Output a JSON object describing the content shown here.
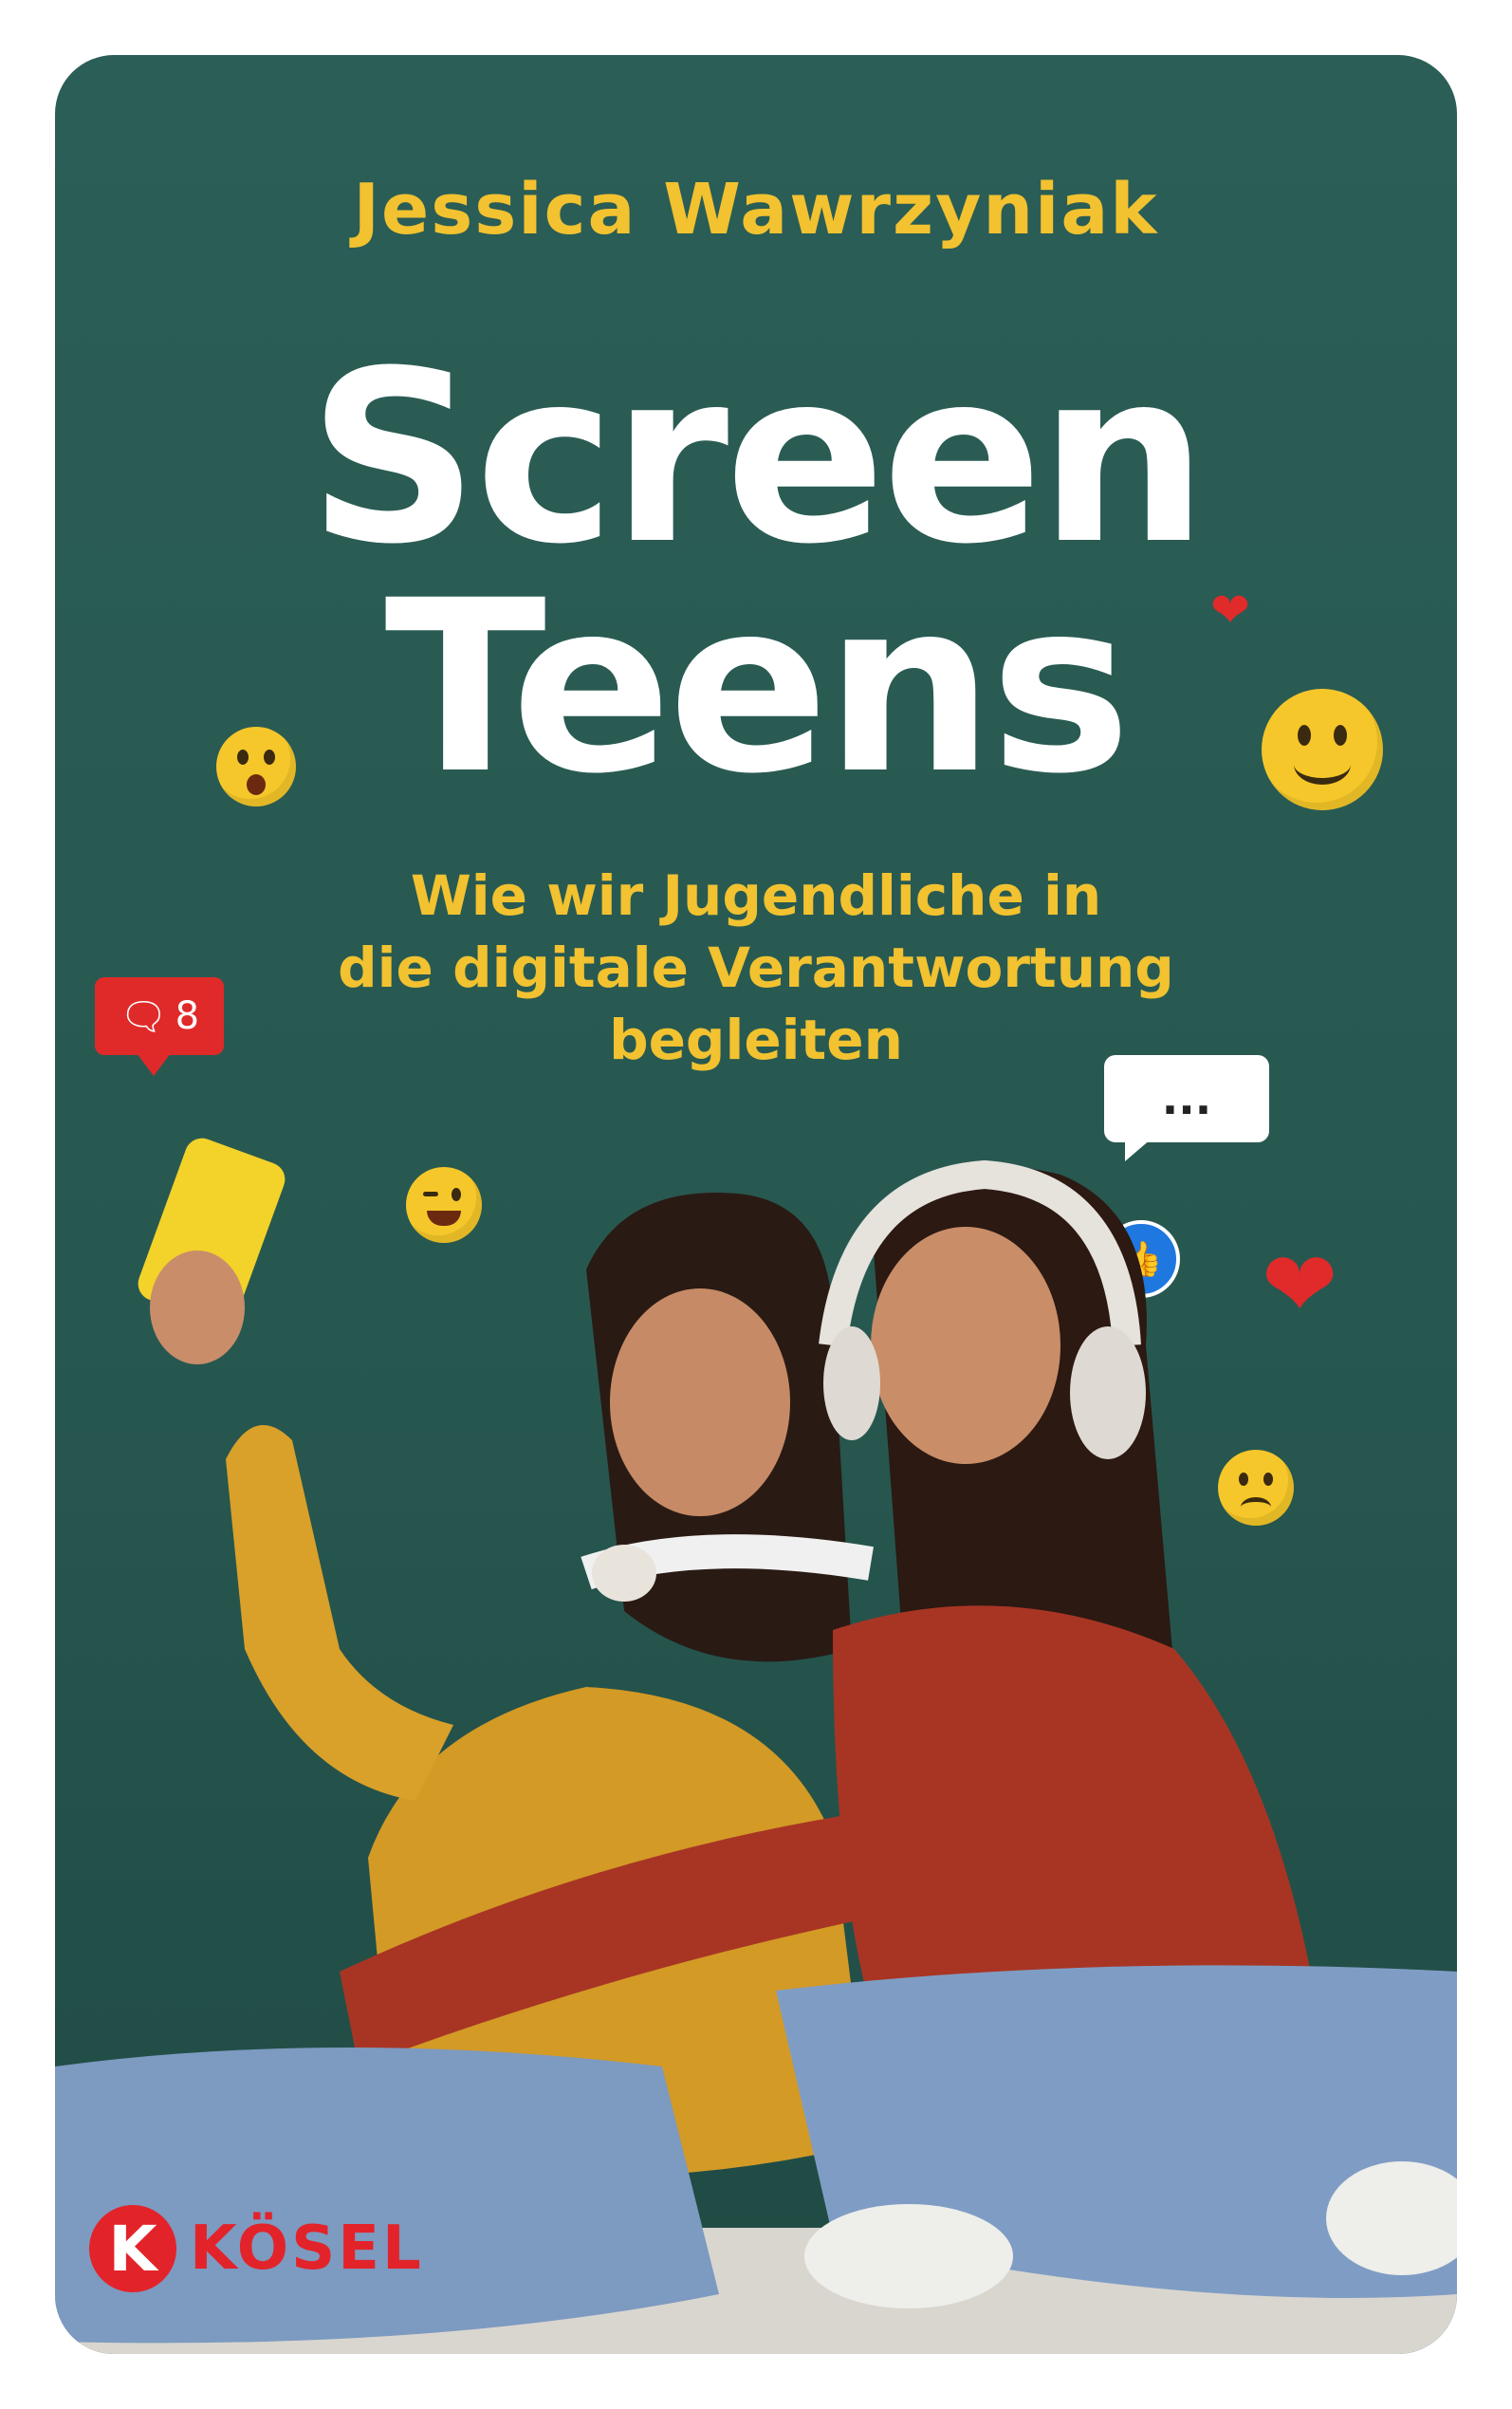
{
  "author": "Jessica Wawrzyniak",
  "title_line1": "Screen",
  "title_line2": "Teens",
  "subtitle": [
    "Wie wir Jugendliche in",
    "die digitale Verantwortung",
    "begleiten"
  ],
  "comment_badge": {
    "icon": "speech-bubble-icon",
    "count": "8"
  },
  "typing_bubble": "...",
  "publisher": {
    "logo_letter": "K",
    "name": "KÖSEL"
  },
  "colors": {
    "background": "#2b5e56",
    "accent_yellow": "#f2c230",
    "title": "#ffffff",
    "brand_red": "#e3232a"
  }
}
